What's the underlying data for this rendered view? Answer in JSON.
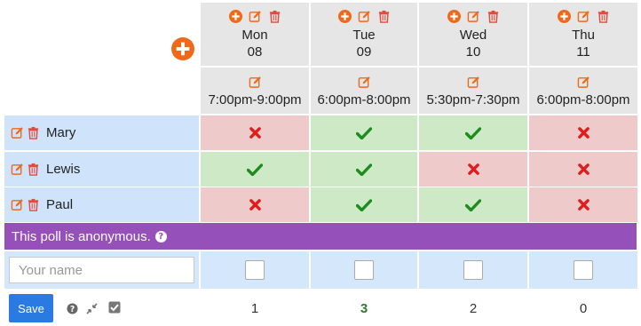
{
  "colors": {
    "action_orange": "#ee6a1a",
    "delete_red": "#e24a3c",
    "yes_green": "#1f8c1f",
    "no_red": "#e01c1c",
    "banner_purple": "#9650b9",
    "save_blue": "#2a7ae2"
  },
  "columns": [
    {
      "day": "Mon",
      "date": "08",
      "time": "7:00pm-9:00pm"
    },
    {
      "day": "Tue",
      "date": "09",
      "time": "6:00pm-8:00pm"
    },
    {
      "day": "Wed",
      "date": "10",
      "time": "5:30pm-7:30pm"
    },
    {
      "day": "Thu",
      "date": "11",
      "time": "6:00pm-8:00pm"
    }
  ],
  "participants": [
    {
      "name": "Mary",
      "votes": [
        "no",
        "yes",
        "yes",
        "no"
      ]
    },
    {
      "name": "Lewis",
      "votes": [
        "yes",
        "yes",
        "no",
        "no"
      ]
    },
    {
      "name": "Paul",
      "votes": [
        "no",
        "yes",
        "yes",
        "no"
      ]
    }
  ],
  "banner": {
    "text": "This poll is anonymous."
  },
  "new_vote": {
    "name_placeholder": "Your name"
  },
  "footer": {
    "save_label": "Save",
    "counts": [
      "1",
      "3",
      "2",
      "0"
    ]
  },
  "icons": {
    "add_column": "plus-circle-icon",
    "edit": "pencil-square-icon",
    "delete": "trash-icon",
    "yes": "check-icon",
    "no": "cross-icon",
    "help": "question-circle-icon",
    "collapse": "compress-icon",
    "select": "checkbox-icon"
  }
}
